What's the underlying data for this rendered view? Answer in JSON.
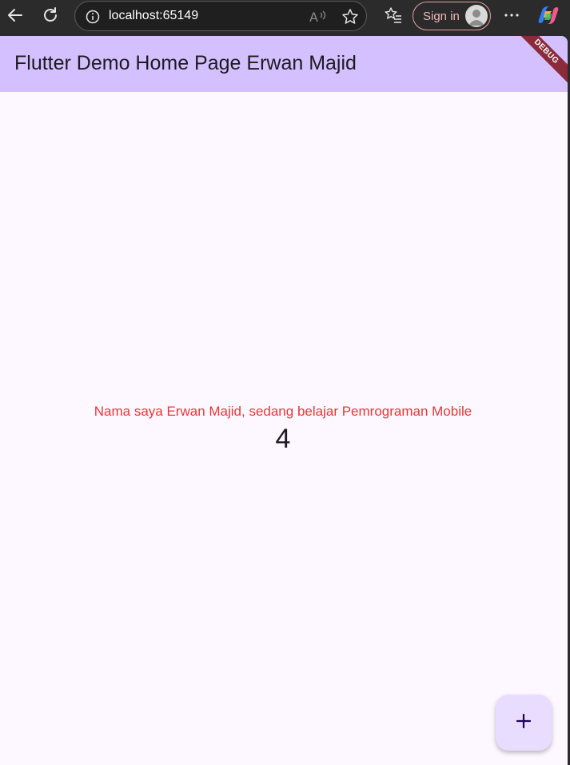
{
  "browser": {
    "url": "localhost:65149",
    "sign_in_label": "Sign in"
  },
  "app": {
    "title": "Flutter Demo Home Page Erwan Majid",
    "debug_banner": "DEBUG",
    "message": "Nama saya Erwan Majid, sedang belajar Pemrograman Mobile",
    "counter": "4"
  },
  "colors": {
    "app_bar": "#d4bfff",
    "background": "#fdf7ff",
    "message": "#e53935",
    "fab": "#e9ddff",
    "debug_ribbon": "#8b2a3a"
  },
  "icons": [
    "back-arrow-icon",
    "refresh-icon",
    "info-icon",
    "read-aloud-icon",
    "favorite-star-icon",
    "favorites-list-icon",
    "avatar-icon",
    "more-options-icon",
    "copilot-icon",
    "plus-icon"
  ]
}
